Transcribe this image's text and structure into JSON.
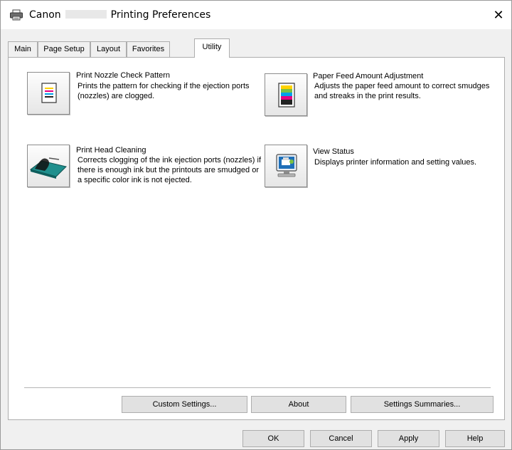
{
  "window": {
    "title_prefix": "Canon",
    "title_suffix": "Printing Preferences",
    "close_glyph": "✕"
  },
  "tabs": [
    {
      "label": "Main"
    },
    {
      "label": "Page Setup"
    },
    {
      "label": "Layout"
    },
    {
      "label": "Favorites"
    },
    {
      "label": "Utility",
      "selected": true
    }
  ],
  "utilities": [
    {
      "title": "Print Nozzle Check Pattern",
      "desc": "Prints the pattern for checking if the ejection ports (nozzles) are clogged.",
      "icon": "nozzle-check-pattern-icon"
    },
    {
      "title": "Paper Feed Amount Adjustment",
      "desc": "Adjusts the paper feed amount to correct smudges and streaks in the print results.",
      "icon": "paper-feed-adjustment-icon"
    },
    {
      "title": "Print Head Cleaning",
      "desc": "Corrects clogging of the ink ejection ports (nozzles) if there is enough ink but the printouts are smudged or a specific color ink is not ejected.",
      "icon": "print-head-cleaning-icon"
    },
    {
      "title": "View Status",
      "desc": "Displays printer information and setting values.",
      "icon": "view-status-monitor-icon"
    }
  ],
  "panel_buttons": {
    "custom_settings": "Custom Settings...",
    "about": "About",
    "settings_summaries": "Settings Summaries..."
  },
  "dialog_buttons": {
    "ok": "OK",
    "cancel": "Cancel",
    "apply": "Apply",
    "help": "Help"
  }
}
